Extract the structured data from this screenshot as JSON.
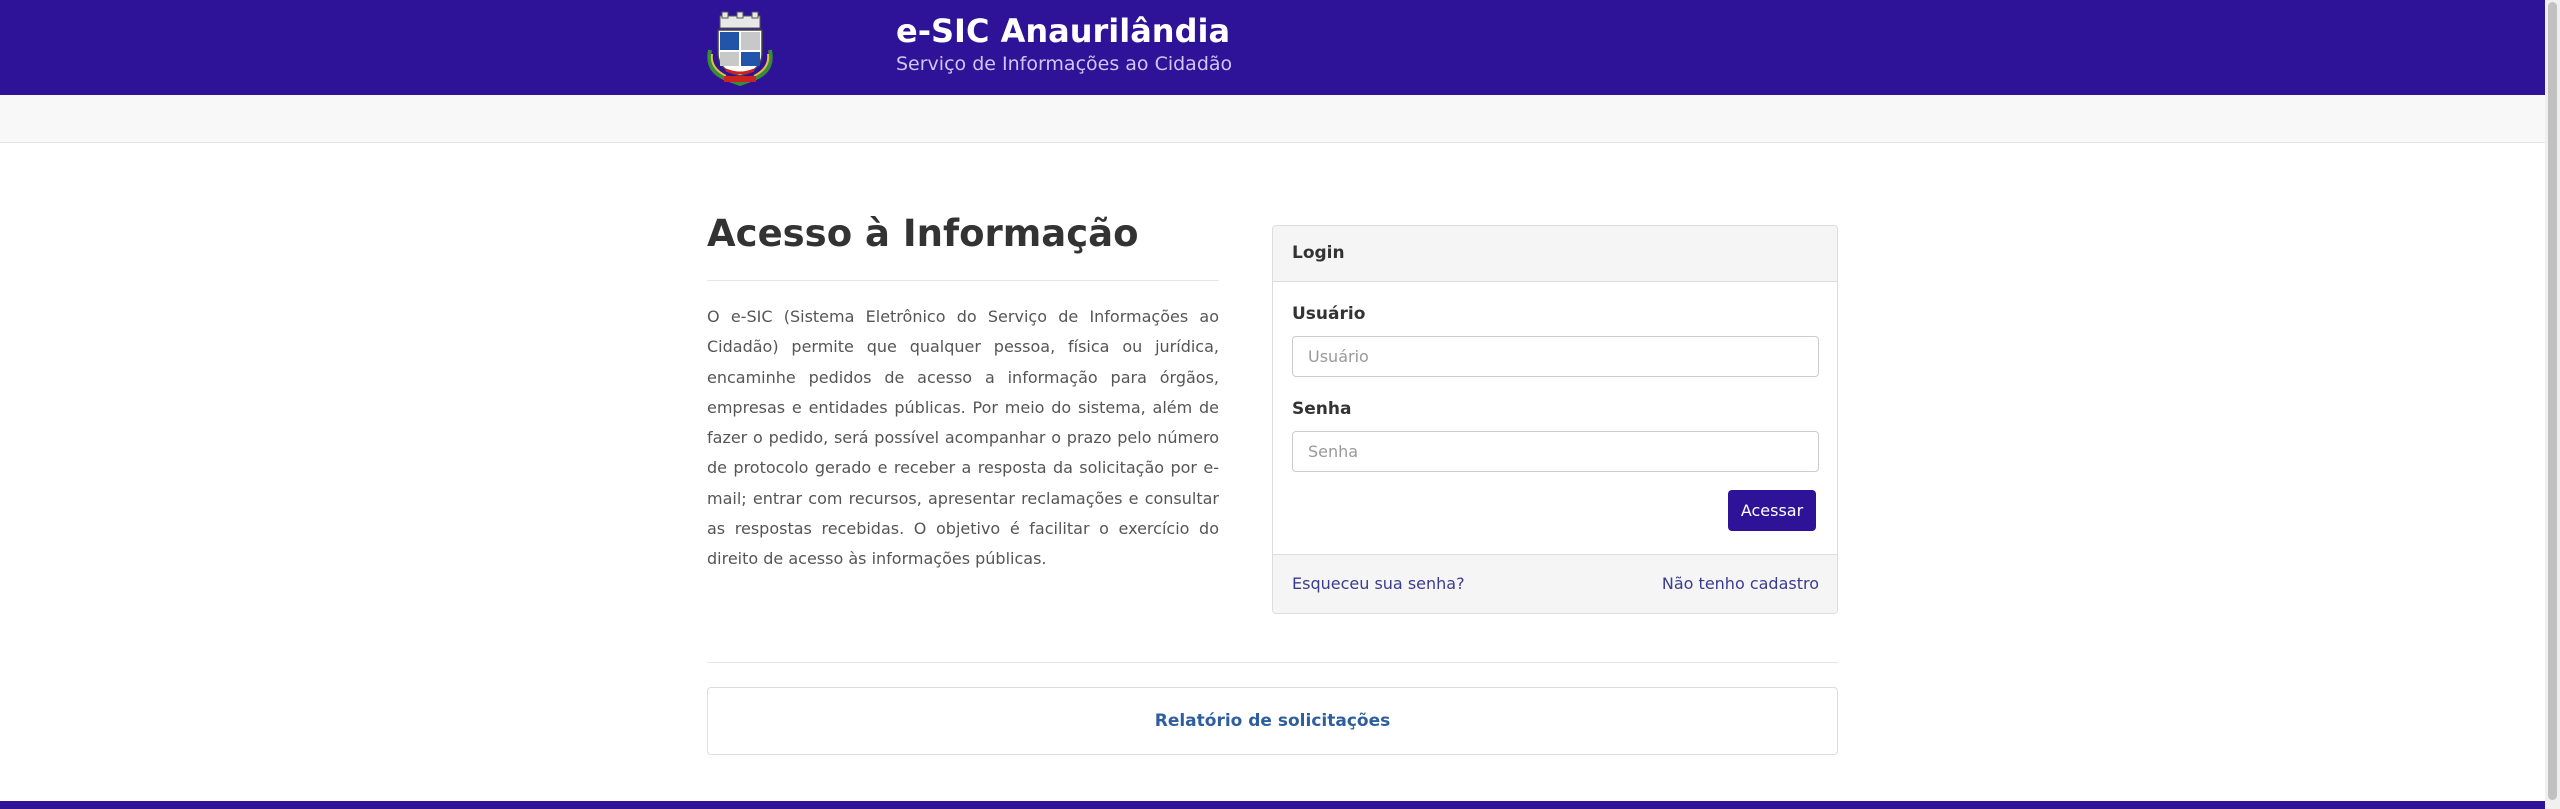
{
  "colors": {
    "primary": "#2e1297",
    "link": "#3b3b8f"
  },
  "header": {
    "logo_icon": "municipal-coat-of-arms-icon",
    "title": "e-SIC Anaurilândia",
    "subtitle": "Serviço de Informações ao Cidadão"
  },
  "info": {
    "title": "Acesso à Informação",
    "text": "O e-SIC (Sistema Eletrônico do Serviço de Informações ao Cidadão) permite que qualquer pessoa, física ou jurídica, encaminhe pedidos de acesso a informação para órgãos, empresas e entidades públicas. Por meio do sistema, além de fazer o pedido, será possível acompanhar o prazo pelo número de protocolo gerado e receber a resposta da solicitação por e-mail; entrar com recursos, apresentar reclamações e consultar as respostas recebidas. O objetivo é facilitar o exercício do direito de acesso às informações públicas."
  },
  "login": {
    "heading": "Login",
    "user_label": "Usuário",
    "user_placeholder": "Usuário",
    "password_label": "Senha",
    "password_placeholder": "Senha",
    "submit_label": "Acessar",
    "forgot_link": "Esqueceu sua senha?",
    "register_link": "Não tenho cadastro"
  },
  "report": {
    "link": "Relatório de solicitações"
  }
}
